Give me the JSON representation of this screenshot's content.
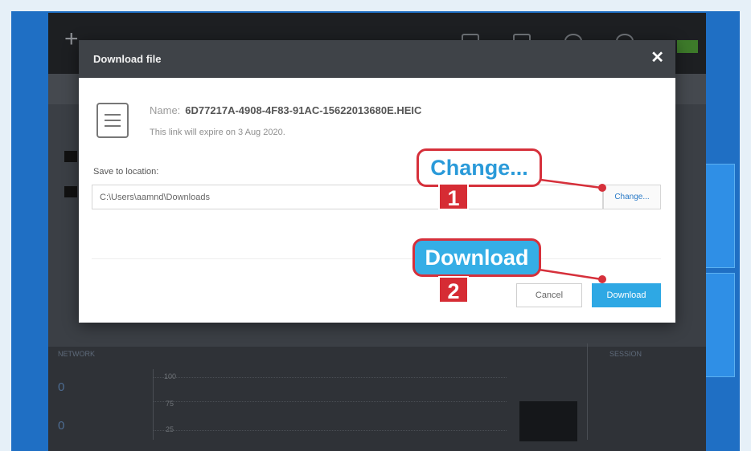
{
  "dialog": {
    "title": "Download file",
    "close_glyph": "✕",
    "file_icon": "document-icon",
    "name_label": "Name:",
    "file_name": "6D77217A-4908-4F83-91AC-15622013680E.HEIC",
    "expiry_note": "This link will expire on 3 Aug 2020.",
    "save_location_label": "Save to location:",
    "save_location_value": "C:\\Users\\aamnd\\Downloads",
    "change_button": "Change...",
    "cancel_button": "Cancel",
    "download_button": "Download"
  },
  "callouts": {
    "change_text": "Change...",
    "change_step": "1",
    "download_text": "Download",
    "download_step": "2"
  },
  "background_app": {
    "add_glyph": "+",
    "network_label": "NETWORK",
    "upload_value": "0",
    "download_value": "0",
    "chart_ticks": [
      "100",
      "75",
      "25"
    ],
    "session_label": "SESSION",
    "status_color": "#3d7a2a"
  },
  "colors": {
    "accent_blue": "#2ea8e4",
    "callout_red": "#d6303b",
    "header_dark": "#3f4348"
  }
}
